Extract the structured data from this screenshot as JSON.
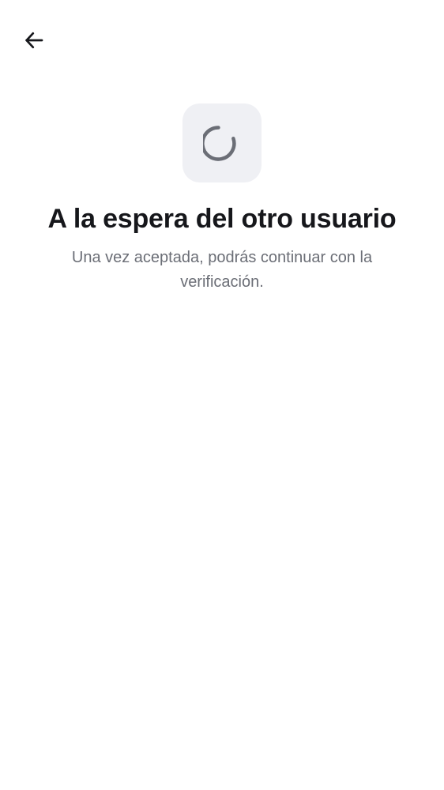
{
  "header": {
    "back_icon": "arrow-left-icon"
  },
  "status": {
    "icon": "loading-spinner-icon",
    "title": "A la espera del otro usuario",
    "message": "Una vez aceptada, podrás continuar con la verificación."
  },
  "colors": {
    "background": "#ffffff",
    "tile": "#eff0f4",
    "spinner": "#6b6e76",
    "title": "#16171b",
    "subtitle": "#6b6e76"
  }
}
